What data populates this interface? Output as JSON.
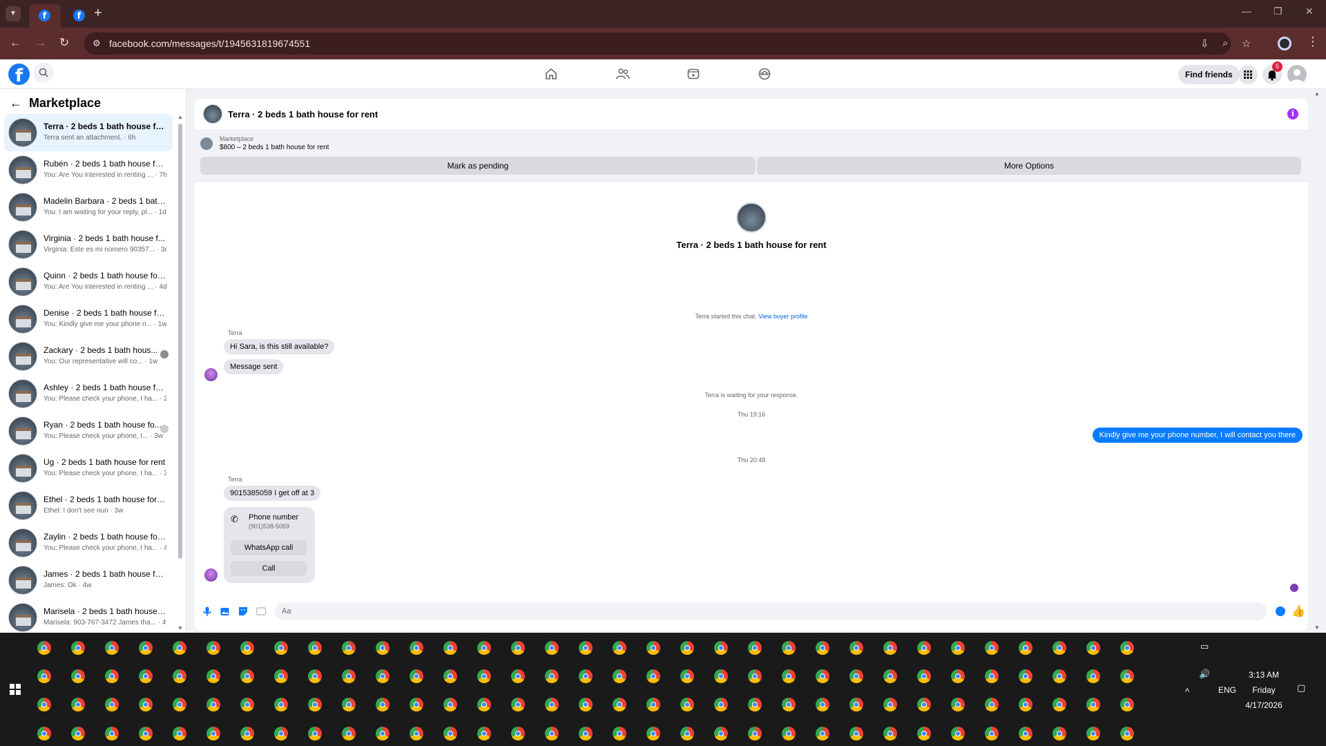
{
  "browser": {
    "url": "facebook.com/messages/t/1945631819674551",
    "tab_list_icon": "chevron-down-icon",
    "new_tab": "+"
  },
  "fb_header": {
    "logo": "f",
    "find_friends": "Find friends",
    "notification_count": "5"
  },
  "sidebar": {
    "title": "Marketplace",
    "conversations": [
      {
        "title": "Terra · 2 beds 1 bath house for r...",
        "sub": "Terra sent an attachment. · 6h"
      },
      {
        "title": "Rubén · 2 beds 1 bath house for...",
        "sub": "You: Are You interested in renting ... · 7h"
      },
      {
        "title": "Madelin Barbara · 2 beds 1 bath...",
        "sub": "You: I am waiting for your reply, pl... · 1d"
      },
      {
        "title": "Virginia · 2 beds 1 bath house f...",
        "sub": "Virginia: Este es mi número 90357... · 3d"
      },
      {
        "title": "Quinn · 2 beds 1 bath house for...",
        "sub": "You: Are You interested in renting ... · 4d"
      },
      {
        "title": "Denise · 2 beds 1 bath house fo...",
        "sub": "You: Kindly give me your phone n... · 1w"
      },
      {
        "title": "Zackary · 2 beds 1 bath hous...",
        "sub": "You: Our representative will co... · 1w"
      },
      {
        "title": "Ashley · 2 beds 1 bath house for...",
        "sub": "You: Please check your phone, I ha... · 2w"
      },
      {
        "title": "Ryan · 2 beds 1 bath house fo...",
        "sub": "You: Please check your phone, I... · 3w"
      },
      {
        "title": "Ug · 2 beds 1 bath house for rent",
        "sub": "You: Please check your phone, I ha... · 3w"
      },
      {
        "title": "Ethel · 2 beds 1 bath house for r...",
        "sub": "Ethel: I don't see nun · 3w"
      },
      {
        "title": "Zaylin · 2 beds 1 bath house for ...",
        "sub": "You: Please check your phone, I ha... · 4w"
      },
      {
        "title": "James · 2 beds 1 bath house for...",
        "sub": "James: Ok · 4w"
      },
      {
        "title": "Marisela · 2 beds 1 bath house f...",
        "sub": "Marisela: 903-767-3472 James tha... · 4w"
      }
    ]
  },
  "chat": {
    "header_title": "Terra · 2 beds 1 bath house for rent",
    "marketplace_label": "Marketplace",
    "listing": "$800 – 2 beds 1 bath house for rent",
    "mark_pending": "Mark as pending",
    "more_options": "More Options",
    "center_title": "Terra · 2 beds 1 bath house for rent",
    "started_text": "Terra started this chat.",
    "view_buyer_profile": "View buyer profile",
    "sender": "Terra",
    "msg1": "Hi Sara, is this still available?",
    "msg2": "Message sent",
    "waiting": "Terra is waiting for your response.",
    "time1": "Thu 19:16",
    "out_msg": "Kindly give me your phone number, I will contact you there",
    "time2": "Thu 20:48",
    "msg3": "9015385059 I get off at 3",
    "phone_label": "Phone number",
    "phone_value": "(901)538-5059",
    "whatsapp_call": "WhatsApp call",
    "call": "Call",
    "composer_placeholder": "Aa"
  },
  "taskbar": {
    "language": "ENG",
    "time": "3:13 AM",
    "day": "Friday",
    "date": "4/17/2026"
  },
  "colors": {
    "fb_blue": "#1877f2",
    "messenger_blue": "#0a7cff",
    "browser_frame": "#5b2d2d"
  }
}
